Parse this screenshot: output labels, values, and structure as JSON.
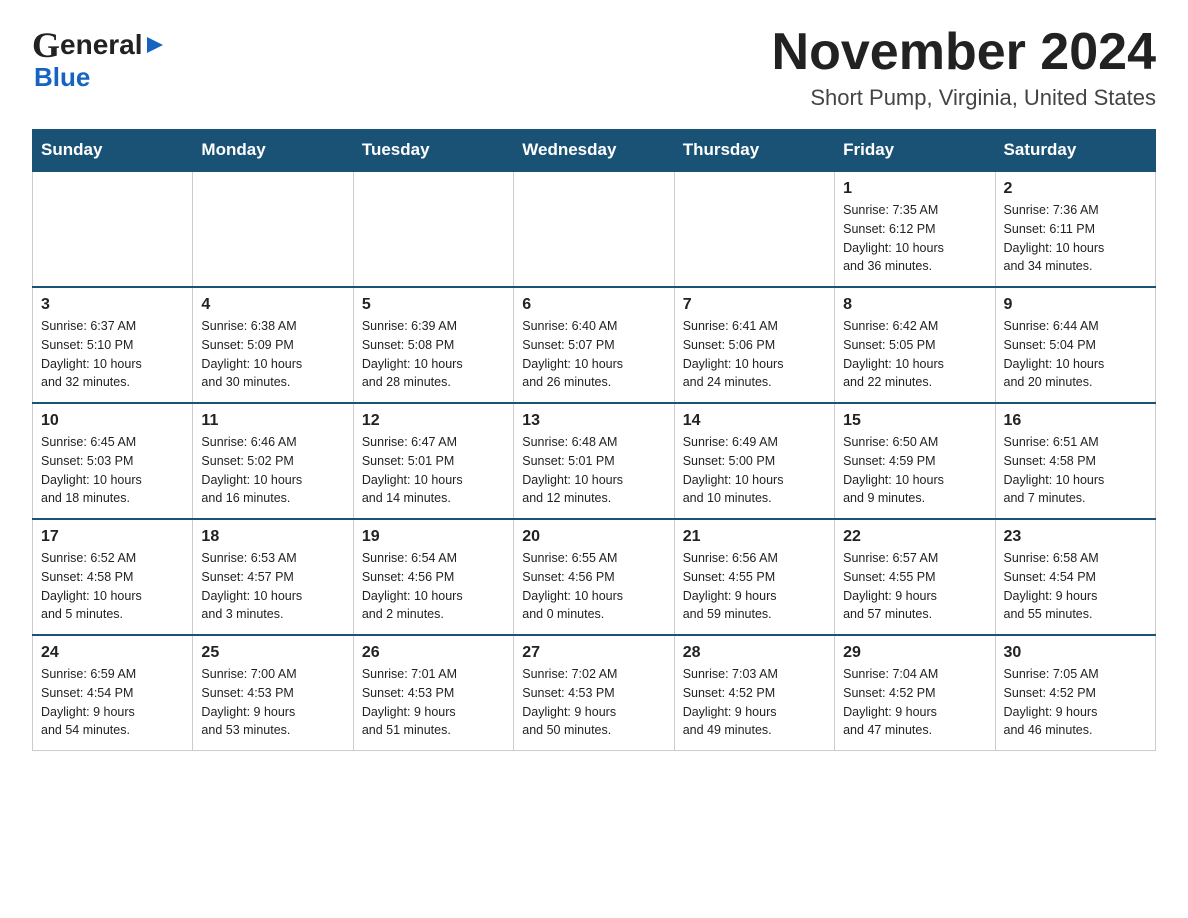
{
  "header": {
    "logo_general": "General",
    "logo_blue": "Blue",
    "month_title": "November 2024",
    "location": "Short Pump, Virginia, United States"
  },
  "calendar": {
    "days_of_week": [
      "Sunday",
      "Monday",
      "Tuesday",
      "Wednesday",
      "Thursday",
      "Friday",
      "Saturday"
    ],
    "weeks": [
      {
        "days": [
          {
            "number": "",
            "info": ""
          },
          {
            "number": "",
            "info": ""
          },
          {
            "number": "",
            "info": ""
          },
          {
            "number": "",
            "info": ""
          },
          {
            "number": "",
            "info": ""
          },
          {
            "number": "1",
            "info": "Sunrise: 7:35 AM\nSunset: 6:12 PM\nDaylight: 10 hours\nand 36 minutes."
          },
          {
            "number": "2",
            "info": "Sunrise: 7:36 AM\nSunset: 6:11 PM\nDaylight: 10 hours\nand 34 minutes."
          }
        ]
      },
      {
        "days": [
          {
            "number": "3",
            "info": "Sunrise: 6:37 AM\nSunset: 5:10 PM\nDaylight: 10 hours\nand 32 minutes."
          },
          {
            "number": "4",
            "info": "Sunrise: 6:38 AM\nSunset: 5:09 PM\nDaylight: 10 hours\nand 30 minutes."
          },
          {
            "number": "5",
            "info": "Sunrise: 6:39 AM\nSunset: 5:08 PM\nDaylight: 10 hours\nand 28 minutes."
          },
          {
            "number": "6",
            "info": "Sunrise: 6:40 AM\nSunset: 5:07 PM\nDaylight: 10 hours\nand 26 minutes."
          },
          {
            "number": "7",
            "info": "Sunrise: 6:41 AM\nSunset: 5:06 PM\nDaylight: 10 hours\nand 24 minutes."
          },
          {
            "number": "8",
            "info": "Sunrise: 6:42 AM\nSunset: 5:05 PM\nDaylight: 10 hours\nand 22 minutes."
          },
          {
            "number": "9",
            "info": "Sunrise: 6:44 AM\nSunset: 5:04 PM\nDaylight: 10 hours\nand 20 minutes."
          }
        ]
      },
      {
        "days": [
          {
            "number": "10",
            "info": "Sunrise: 6:45 AM\nSunset: 5:03 PM\nDaylight: 10 hours\nand 18 minutes."
          },
          {
            "number": "11",
            "info": "Sunrise: 6:46 AM\nSunset: 5:02 PM\nDaylight: 10 hours\nand 16 minutes."
          },
          {
            "number": "12",
            "info": "Sunrise: 6:47 AM\nSunset: 5:01 PM\nDaylight: 10 hours\nand 14 minutes."
          },
          {
            "number": "13",
            "info": "Sunrise: 6:48 AM\nSunset: 5:01 PM\nDaylight: 10 hours\nand 12 minutes."
          },
          {
            "number": "14",
            "info": "Sunrise: 6:49 AM\nSunset: 5:00 PM\nDaylight: 10 hours\nand 10 minutes."
          },
          {
            "number": "15",
            "info": "Sunrise: 6:50 AM\nSunset: 4:59 PM\nDaylight: 10 hours\nand 9 minutes."
          },
          {
            "number": "16",
            "info": "Sunrise: 6:51 AM\nSunset: 4:58 PM\nDaylight: 10 hours\nand 7 minutes."
          }
        ]
      },
      {
        "days": [
          {
            "number": "17",
            "info": "Sunrise: 6:52 AM\nSunset: 4:58 PM\nDaylight: 10 hours\nand 5 minutes."
          },
          {
            "number": "18",
            "info": "Sunrise: 6:53 AM\nSunset: 4:57 PM\nDaylight: 10 hours\nand 3 minutes."
          },
          {
            "number": "19",
            "info": "Sunrise: 6:54 AM\nSunset: 4:56 PM\nDaylight: 10 hours\nand 2 minutes."
          },
          {
            "number": "20",
            "info": "Sunrise: 6:55 AM\nSunset: 4:56 PM\nDaylight: 10 hours\nand 0 minutes."
          },
          {
            "number": "21",
            "info": "Sunrise: 6:56 AM\nSunset: 4:55 PM\nDaylight: 9 hours\nand 59 minutes."
          },
          {
            "number": "22",
            "info": "Sunrise: 6:57 AM\nSunset: 4:55 PM\nDaylight: 9 hours\nand 57 minutes."
          },
          {
            "number": "23",
            "info": "Sunrise: 6:58 AM\nSunset: 4:54 PM\nDaylight: 9 hours\nand 55 minutes."
          }
        ]
      },
      {
        "days": [
          {
            "number": "24",
            "info": "Sunrise: 6:59 AM\nSunset: 4:54 PM\nDaylight: 9 hours\nand 54 minutes."
          },
          {
            "number": "25",
            "info": "Sunrise: 7:00 AM\nSunset: 4:53 PM\nDaylight: 9 hours\nand 53 minutes."
          },
          {
            "number": "26",
            "info": "Sunrise: 7:01 AM\nSunset: 4:53 PM\nDaylight: 9 hours\nand 51 minutes."
          },
          {
            "number": "27",
            "info": "Sunrise: 7:02 AM\nSunset: 4:53 PM\nDaylight: 9 hours\nand 50 minutes."
          },
          {
            "number": "28",
            "info": "Sunrise: 7:03 AM\nSunset: 4:52 PM\nDaylight: 9 hours\nand 49 minutes."
          },
          {
            "number": "29",
            "info": "Sunrise: 7:04 AM\nSunset: 4:52 PM\nDaylight: 9 hours\nand 47 minutes."
          },
          {
            "number": "30",
            "info": "Sunrise: 7:05 AM\nSunset: 4:52 PM\nDaylight: 9 hours\nand 46 minutes."
          }
        ]
      }
    ]
  }
}
